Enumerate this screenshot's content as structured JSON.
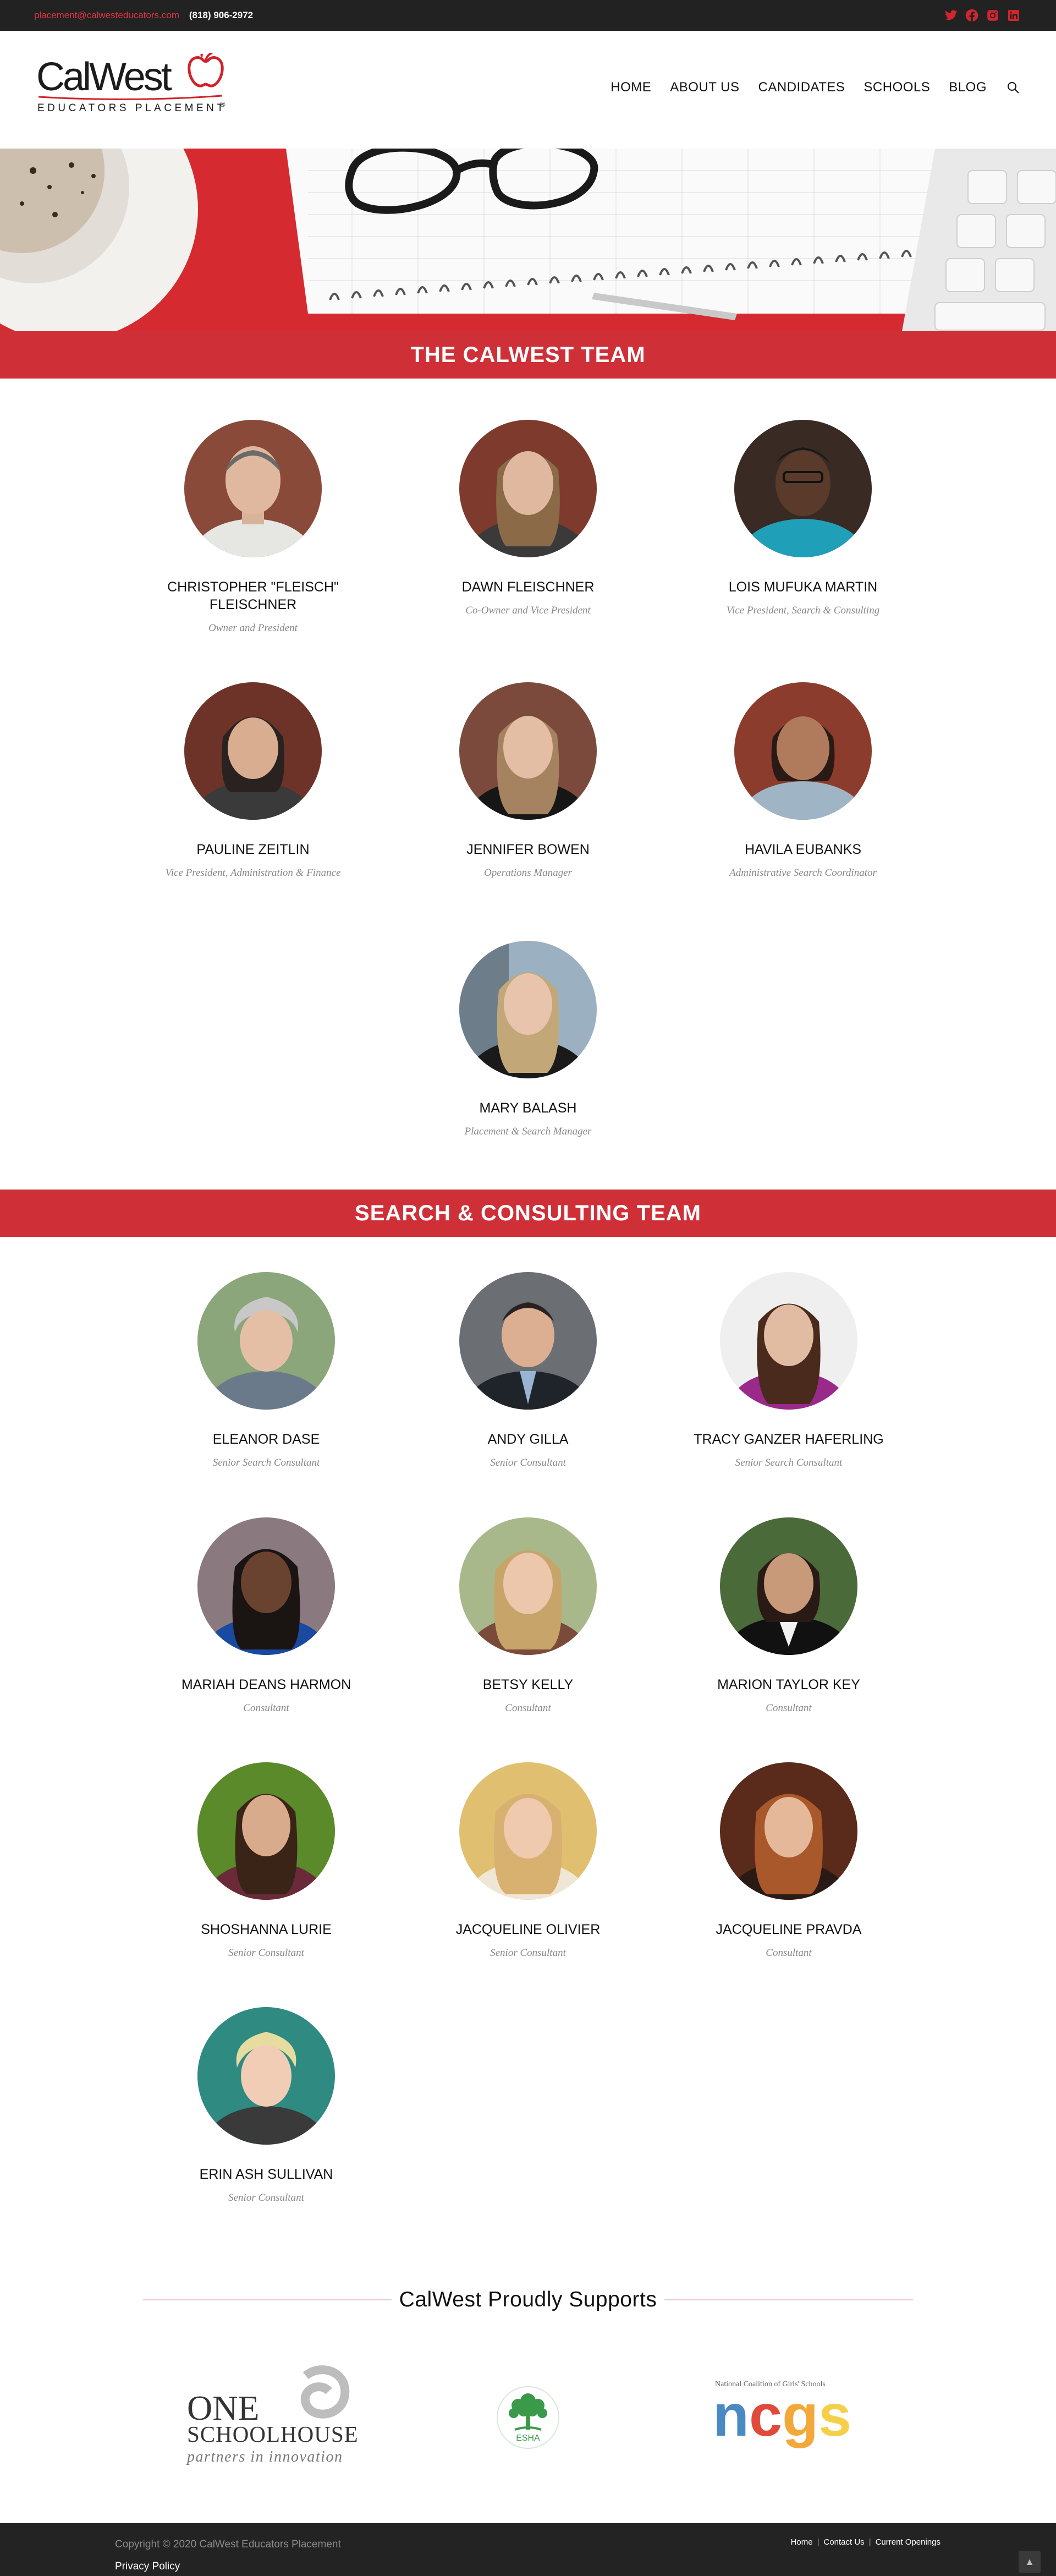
{
  "topbar": {
    "email": "placement@calwesteducators.com",
    "phone": "(818) 906-2972",
    "social": [
      "twitter-icon",
      "facebook-icon",
      "instagram-icon",
      "linkedin-icon"
    ],
    "social_color": "#d0262f"
  },
  "header": {
    "logo_main": "CalWest",
    "logo_sub": "EDUCATORS PLACEMENT",
    "logo_mark": "®",
    "nav": [
      "HOME",
      "ABOUT US",
      "CANDIDATES",
      "SCHOOLS",
      "BLOG"
    ]
  },
  "sections": {
    "team_title": "THE CALWEST TEAM",
    "consulting_title": "SEARCH & CONSULTING TEAM",
    "band_color": "#cf3038"
  },
  "team": [
    {
      "name": "CHRISTOPHER \"FLEISCH\" FLEISCHNER",
      "role": "Owner and President"
    },
    {
      "name": "DAWN FLEISCHNER",
      "role": "Co-Owner and Vice President"
    },
    {
      "name": "LOIS MUFUKA MARTIN",
      "role": "Vice President, Search & Consulting"
    },
    {
      "name": "PAULINE ZEITLIN",
      "role": "Vice President, Administration & Finance"
    },
    {
      "name": "JENNIFER BOWEN",
      "role": "Operations Manager"
    },
    {
      "name": "HAVILA EUBANKS",
      "role": "Administrative Search Coordinator"
    },
    {
      "name": "MARY BALASH",
      "role": "Placement & Search Manager"
    }
  ],
  "consultants": [
    {
      "name": "ELEANOR DASE",
      "role": "Senior Search Consultant"
    },
    {
      "name": "ANDY GILLA",
      "role": "Senior Consultant"
    },
    {
      "name": "TRACY GANZER HAFERLING",
      "role": "Senior Search Consultant"
    },
    {
      "name": "MARIAH DEANS HARMON",
      "role": "Consultant"
    },
    {
      "name": "BETSY KELLY",
      "role": "Consultant"
    },
    {
      "name": "MARION TAYLOR KEY",
      "role": "Consultant"
    },
    {
      "name": "SHOSHANNA LURIE",
      "role": "Senior Consultant"
    },
    {
      "name": "JACQUELINE OLIVIER",
      "role": "Senior Consultant"
    },
    {
      "name": "JACQUELINE PRAVDA",
      "role": "Consultant"
    },
    {
      "name": "ERIN ASH SULLIVAN",
      "role": "Senior Consultant"
    }
  ],
  "supports": {
    "title": "CalWest Proudly Supports",
    "one_schoolhouse": {
      "line1": "ONE",
      "line2": "SCHOOLHOUSE",
      "tagline": "partners in innovation"
    },
    "esha": {
      "label": "ESHA"
    },
    "ncgs": {
      "small": "National Coalition of Girls' Schools",
      "letters": "ncgs"
    }
  },
  "footer": {
    "copyright": "Copyright © 2020 CalWest Educators Placement",
    "privacy": "Privacy Policy",
    "links": [
      "Home",
      "Contact Us",
      "Current Openings"
    ]
  }
}
